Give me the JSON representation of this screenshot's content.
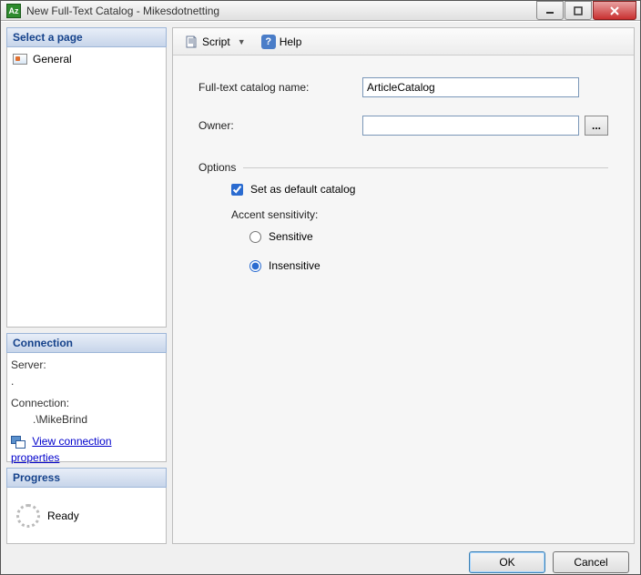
{
  "window": {
    "title": "New Full-Text Catalog - Mikesdotnetting"
  },
  "sidebar": {
    "select_page_header": "Select a page",
    "pages": [
      {
        "label": "General"
      }
    ],
    "connection_header": "Connection",
    "server_label": "Server:",
    "server_value": ".",
    "connection_label": "Connection:",
    "connection_value": ".\\MikeBrind",
    "view_props_link": "View connection properties",
    "progress_header": "Progress",
    "progress_status": "Ready"
  },
  "toolbar": {
    "script_label": "Script",
    "help_label": "Help"
  },
  "form": {
    "catalog_name_label": "Full-text catalog name:",
    "catalog_name_value": "ArticleCatalog",
    "owner_label": "Owner:",
    "owner_value": "",
    "options_label": "Options",
    "default_catalog_label": "Set as default catalog",
    "default_catalog_checked": true,
    "accent_label": "Accent sensitivity:",
    "accent_options": {
      "sensitive": "Sensitive",
      "insensitive": "Insensitive"
    },
    "accent_selected": "insensitive"
  },
  "footer": {
    "ok": "OK",
    "cancel": "Cancel"
  }
}
